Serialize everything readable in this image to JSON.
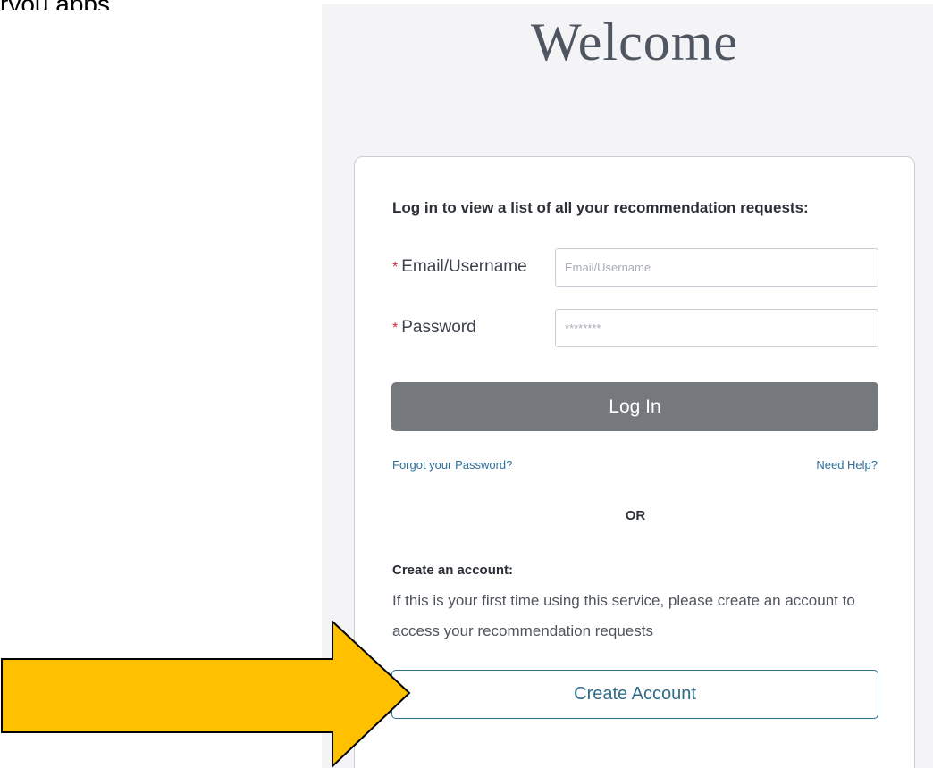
{
  "top_fragment": "ryou apps",
  "welcome": {
    "title": "Welcome"
  },
  "login": {
    "intro": "Log in to view a list of all your recommendation requests:",
    "email_label": "Email/Username",
    "email_placeholder": "Email/Username",
    "password_label": "Password",
    "password_placeholder": "********",
    "required_marker": "*",
    "login_button": "Log In",
    "forgot_link": "Forgot your Password?",
    "help_link": "Need Help?"
  },
  "divider": {
    "text": "OR"
  },
  "create": {
    "heading": "Create an account:",
    "description": "If this is your first time using this service, please create an account to access your recommendation requests",
    "button": "Create Account"
  },
  "annotation": {
    "arrow_color": "#ffc000",
    "arrow_icon": "right-arrow-icon"
  },
  "colors": {
    "panel_bg": "#f4f4f6",
    "login_button_bg": "#75787d",
    "link": "#2f6f9a",
    "create_button_border": "#2e6e8a",
    "required": "#c6323c"
  }
}
